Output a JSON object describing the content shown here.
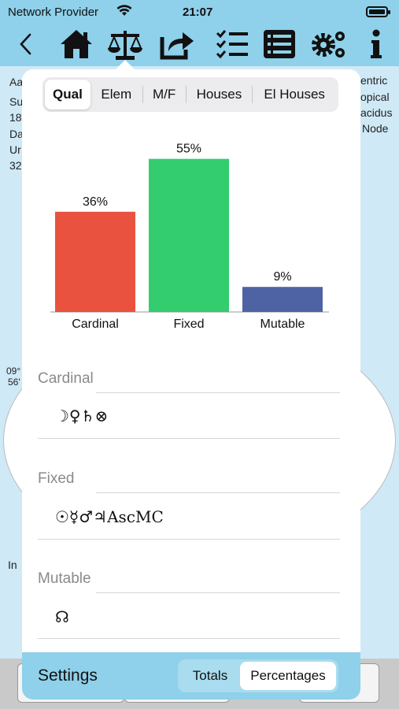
{
  "status_bar": {
    "carrier": "Network Provider",
    "time": "21:07"
  },
  "toolbar": {
    "icons": [
      "back-icon",
      "home-icon",
      "scales-icon",
      "share-icon",
      "checklist-icon",
      "list-icon",
      "gears-icon",
      "info-icon"
    ]
  },
  "background": {
    "left_fragments": [
      "Aa",
      "Su",
      "18",
      "Da",
      "Ur",
      "32"
    ],
    "right_fragments": [
      "entric",
      "opical",
      "acidus",
      "Node"
    ],
    "mid_fragments": [
      "09°",
      "56'",
      "In"
    ]
  },
  "tabs": [
    {
      "label": "Qual",
      "active": true
    },
    {
      "label": "Elem",
      "active": false
    },
    {
      "label": "M/F",
      "active": false
    },
    {
      "label": "Houses",
      "active": false
    },
    {
      "label": "El Houses",
      "active": false
    }
  ],
  "chart_data": {
    "type": "bar",
    "categories": [
      "Cardinal",
      "Fixed",
      "Mutable"
    ],
    "values": [
      36,
      55,
      9
    ],
    "value_labels": [
      "36%",
      "55%",
      "9%"
    ],
    "colors": [
      "#e8523f",
      "#33cc6e",
      "#4e63a3"
    ],
    "ylim": [
      0,
      60
    ]
  },
  "sections": [
    {
      "title": "Cardinal",
      "symbols": "☽♀♄⊗"
    },
    {
      "title": "Fixed",
      "symbols": "☉☿♂♃AscMC"
    },
    {
      "title": "Mutable",
      "symbols": "☊"
    }
  ],
  "bottom": {
    "settings_label": "Settings",
    "toggle": [
      {
        "label": "Totals",
        "active": false
      },
      {
        "label": "Percentages",
        "active": true
      }
    ]
  }
}
